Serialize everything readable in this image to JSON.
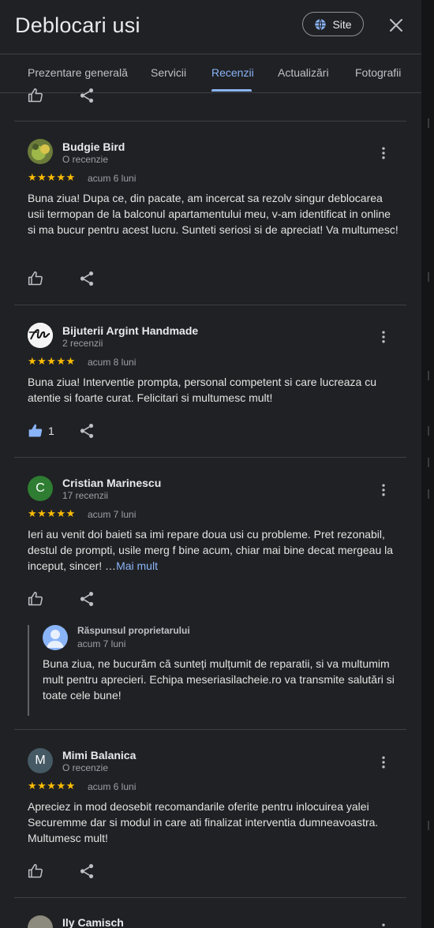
{
  "header": {
    "title": "Deblocari usi",
    "site_label": "Site"
  },
  "tabs": [
    "Prezentare generală",
    "Servicii",
    "Recenzii",
    "Actualizări",
    "Fotografii"
  ],
  "active_tab": "Recenzii",
  "reviews": [
    {
      "name": "Budgie Bird",
      "count": "O recenzie",
      "rating": 5,
      "stars": "★★★★★",
      "when": "acum 6 luni",
      "text": "Buna ziua! Dupa ce, din pacate, am incercat sa rezolv singur deblocarea usii termopan de la balconul apartamentului meu, v-am identificat in online si ma bucur pentru acest lucru. Sunteti seriosi si de apreciat! Va multumesc!",
      "likes": ""
    },
    {
      "name": "Bijuterii Argint Handmade",
      "count": "2 recenzii",
      "rating": 5,
      "stars": "★★★★★",
      "when": "acum 8 luni",
      "text": "Buna ziua! Interventie prompta, personal competent si care lucreaza cu atentie si foarte curat. Felicitari si multumesc mult!",
      "likes": "1"
    },
    {
      "name": "Cristian Marinescu",
      "avatar_letter": "C",
      "count": "17 recenzii",
      "rating": 5,
      "stars": "★★★★★",
      "when": "acum 7 luni",
      "text": "Ieri au venit doi baieti sa imi repare doua usi cu probleme. Pret rezonabil, destul de prompti, usile merg f bine acum, chiar mai bine decat mergeau la inceput, sincer! …",
      "more_label": "Mai mult",
      "likes": "",
      "owner_response": {
        "label": "Răspunsul proprietarului",
        "when": "acum 7 luni",
        "text": "Buna ziua, ne bucurăm că sunteți mulțumit de reparatii, si va multumim mult pentru aprecieri. Echipa meseriasilacheie.ro va transmite salutări si toate cele bune!"
      }
    },
    {
      "name": "Mimi Balanica",
      "avatar_letter": "M",
      "count": "O recenzie",
      "rating": 5,
      "stars": "★★★★★",
      "when": "acum 6 luni",
      "text": "Apreciez in mod deosebit recomandarile oferite pentru inlocuirea yalei Securemme dar si modul in care ati finalizat interventia dumneavoastra. Multumesc mult!",
      "likes": ""
    },
    {
      "name": "Ily Camisch"
    }
  ],
  "colors": {
    "background": "#202124",
    "accent": "#8ab4f8",
    "star": "#fbbc04",
    "avatar_cristian": "#2e7d32",
    "avatar_mimi": "#455a64"
  },
  "icons": [
    "globe-icon",
    "close-icon",
    "thumb-up-icon",
    "share-icon",
    "more-vert-icon"
  ]
}
